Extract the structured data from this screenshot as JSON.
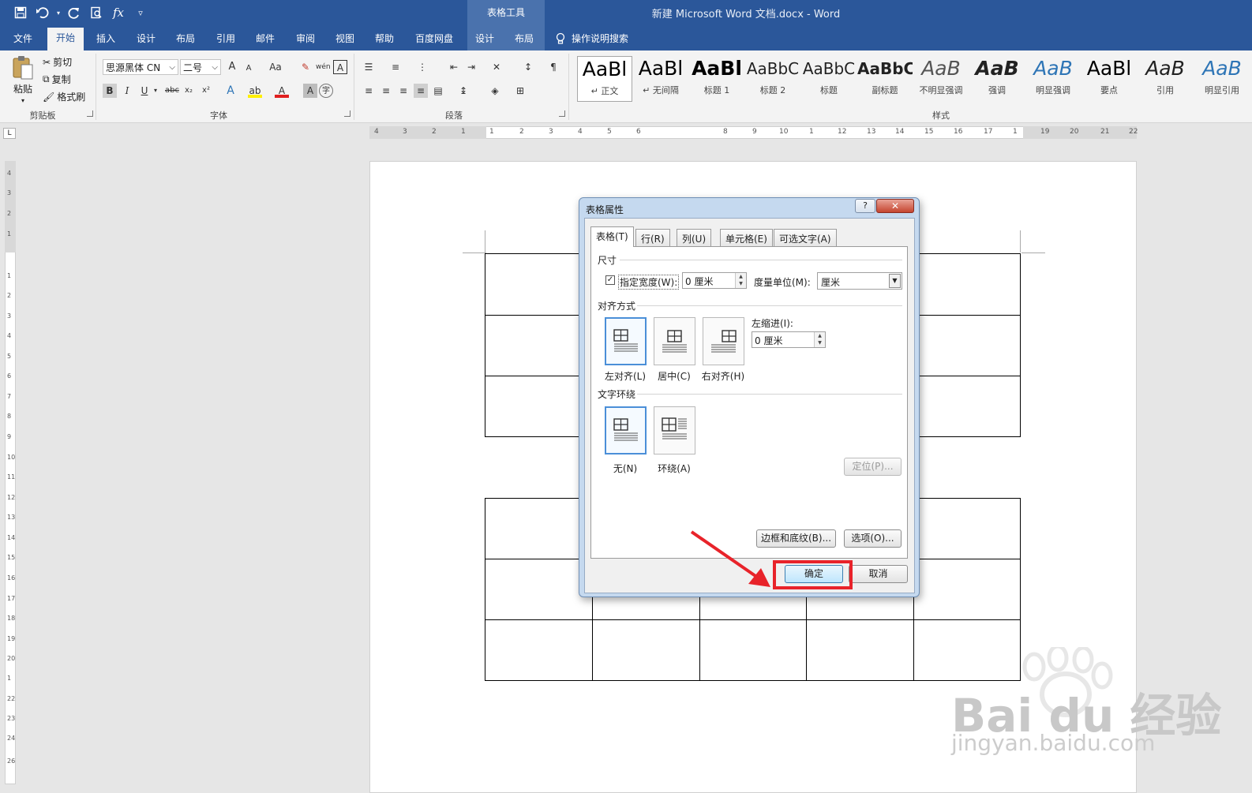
{
  "window": {
    "doc_title": "新建 Microsoft Word 文档.docx  -  Word",
    "context_label": "表格工具"
  },
  "qat": {
    "save": "save-icon",
    "undo": "undo-icon",
    "redo": "redo-icon",
    "preview": "print-preview-icon",
    "formula": "fx",
    "more": "▿"
  },
  "tabs": [
    "文件",
    "开始",
    "插入",
    "设计",
    "布局",
    "引用",
    "邮件",
    "审阅",
    "视图",
    "帮助",
    "百度网盘",
    "设计",
    "布局"
  ],
  "tell_me": "操作说明搜索",
  "ribbon": {
    "clipboard": {
      "paste": "粘贴",
      "cut": "剪切",
      "copy": "复制",
      "painter": "格式刷",
      "group": "剪贴板"
    },
    "font": {
      "family": "思源黑体 CN",
      "size": "二号",
      "group": "字体",
      "bold": "B",
      "italic": "I",
      "underline": "U",
      "strike": "abc",
      "sub": "x₂",
      "sup": "x²",
      "grow": "A",
      "shrink": "A",
      "case": "Aa"
    },
    "paragraph": {
      "group": "段落"
    },
    "styles": {
      "group": "样式",
      "items": [
        {
          "sample": "AaBl",
          "name": "↵ 正文"
        },
        {
          "sample": "AaBl",
          "name": "↵ 无间隔"
        },
        {
          "sample": "AaBl",
          "name": "标题 1"
        },
        {
          "sample": "AaBbC",
          "name": "标题 2"
        },
        {
          "sample": "AaBbC",
          "name": "标题"
        },
        {
          "sample": "AaBbC",
          "name": "副标题"
        },
        {
          "sample": "AaB",
          "name": "不明显强调"
        },
        {
          "sample": "AaB",
          "name": "强调"
        },
        {
          "sample": "AaB",
          "name": "明显强调"
        },
        {
          "sample": "AaBl",
          "name": "要点"
        },
        {
          "sample": "AaB",
          "name": "引用"
        },
        {
          "sample": "AaB",
          "name": "明显引用"
        }
      ]
    }
  },
  "ruler": {
    "h_numbers": [
      "4",
      "3",
      "2",
      "1",
      "1",
      "2",
      "3",
      "4",
      "5",
      "6",
      "8",
      "9",
      "10",
      "1",
      "12",
      "13",
      "14",
      "15",
      "16",
      "17",
      "1",
      "19",
      "20",
      "21",
      "22"
    ],
    "v_numbers": [
      "4",
      "3",
      "2",
      "1",
      "1",
      "2",
      "3",
      "4",
      "5",
      "6",
      "7",
      "8",
      "9",
      "10",
      "11",
      "12",
      "13",
      "14",
      "15",
      "16",
      "17",
      "18",
      "19",
      "20",
      "1",
      "22",
      "23",
      "24",
      "26"
    ],
    "corner": "L"
  },
  "dialog": {
    "title": "表格属性",
    "help": "?",
    "close": "✕",
    "tabs": [
      "表格(T)",
      "行(R)",
      "列(U)",
      "单元格(E)",
      "可选文字(A)"
    ],
    "size_section": "尺寸",
    "specify_width_label": "指定宽度(W):",
    "specify_width_checked": "✓",
    "width_value": "0 厘米",
    "measure_label": "度量单位(M):",
    "measure_value": "厘米",
    "alignment_section": "对齐方式",
    "align_options": [
      "左对齐(L)",
      "居中(C)",
      "右对齐(H)"
    ],
    "indent_label": "左缩进(I):",
    "indent_value": "0 厘米",
    "wrap_section": "文字环绕",
    "wrap_options": [
      "无(N)",
      "环绕(A)"
    ],
    "position_button": "定位(P)...",
    "borders_button": "边框和底纹(B)...",
    "options_button": "选项(O)...",
    "ok_button": "确定",
    "cancel_button": "取消"
  },
  "watermark": {
    "line1": "Bai du 经验",
    "line2": "jingyan.baidu.com"
  },
  "colors": {
    "title_bar": "#2b579a",
    "context_tab": "#4a72ad",
    "highlight": "#e8232a"
  }
}
